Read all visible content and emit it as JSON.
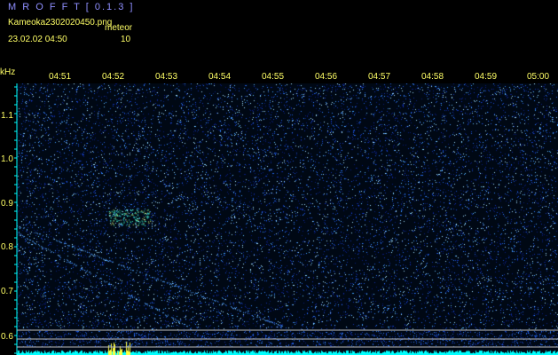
{
  "header": {
    "title": "M R O F F T [ 0.1.3 ]",
    "filename": "Kameoka2302020450.png",
    "detection_label": "meteor",
    "timestamp": "23.02.02 04:50",
    "count": "10"
  },
  "spectrogram": {
    "unit_label": "kHz",
    "time_ticks": [
      "04:51",
      "04:52",
      "04:53",
      "04:54",
      "04:55",
      "04:56",
      "04:57",
      "04:58",
      "04:59",
      "05:00"
    ],
    "freq_ticks": [
      "1.1",
      "1.0",
      "0.9",
      "0.8",
      "0.7",
      "0.6"
    ],
    "colors": {
      "text": "#ffff66",
      "title": "#8f8fff",
      "noise_bg": "#000814",
      "signal": "#00ffff",
      "axis": "#00ffff"
    }
  }
}
